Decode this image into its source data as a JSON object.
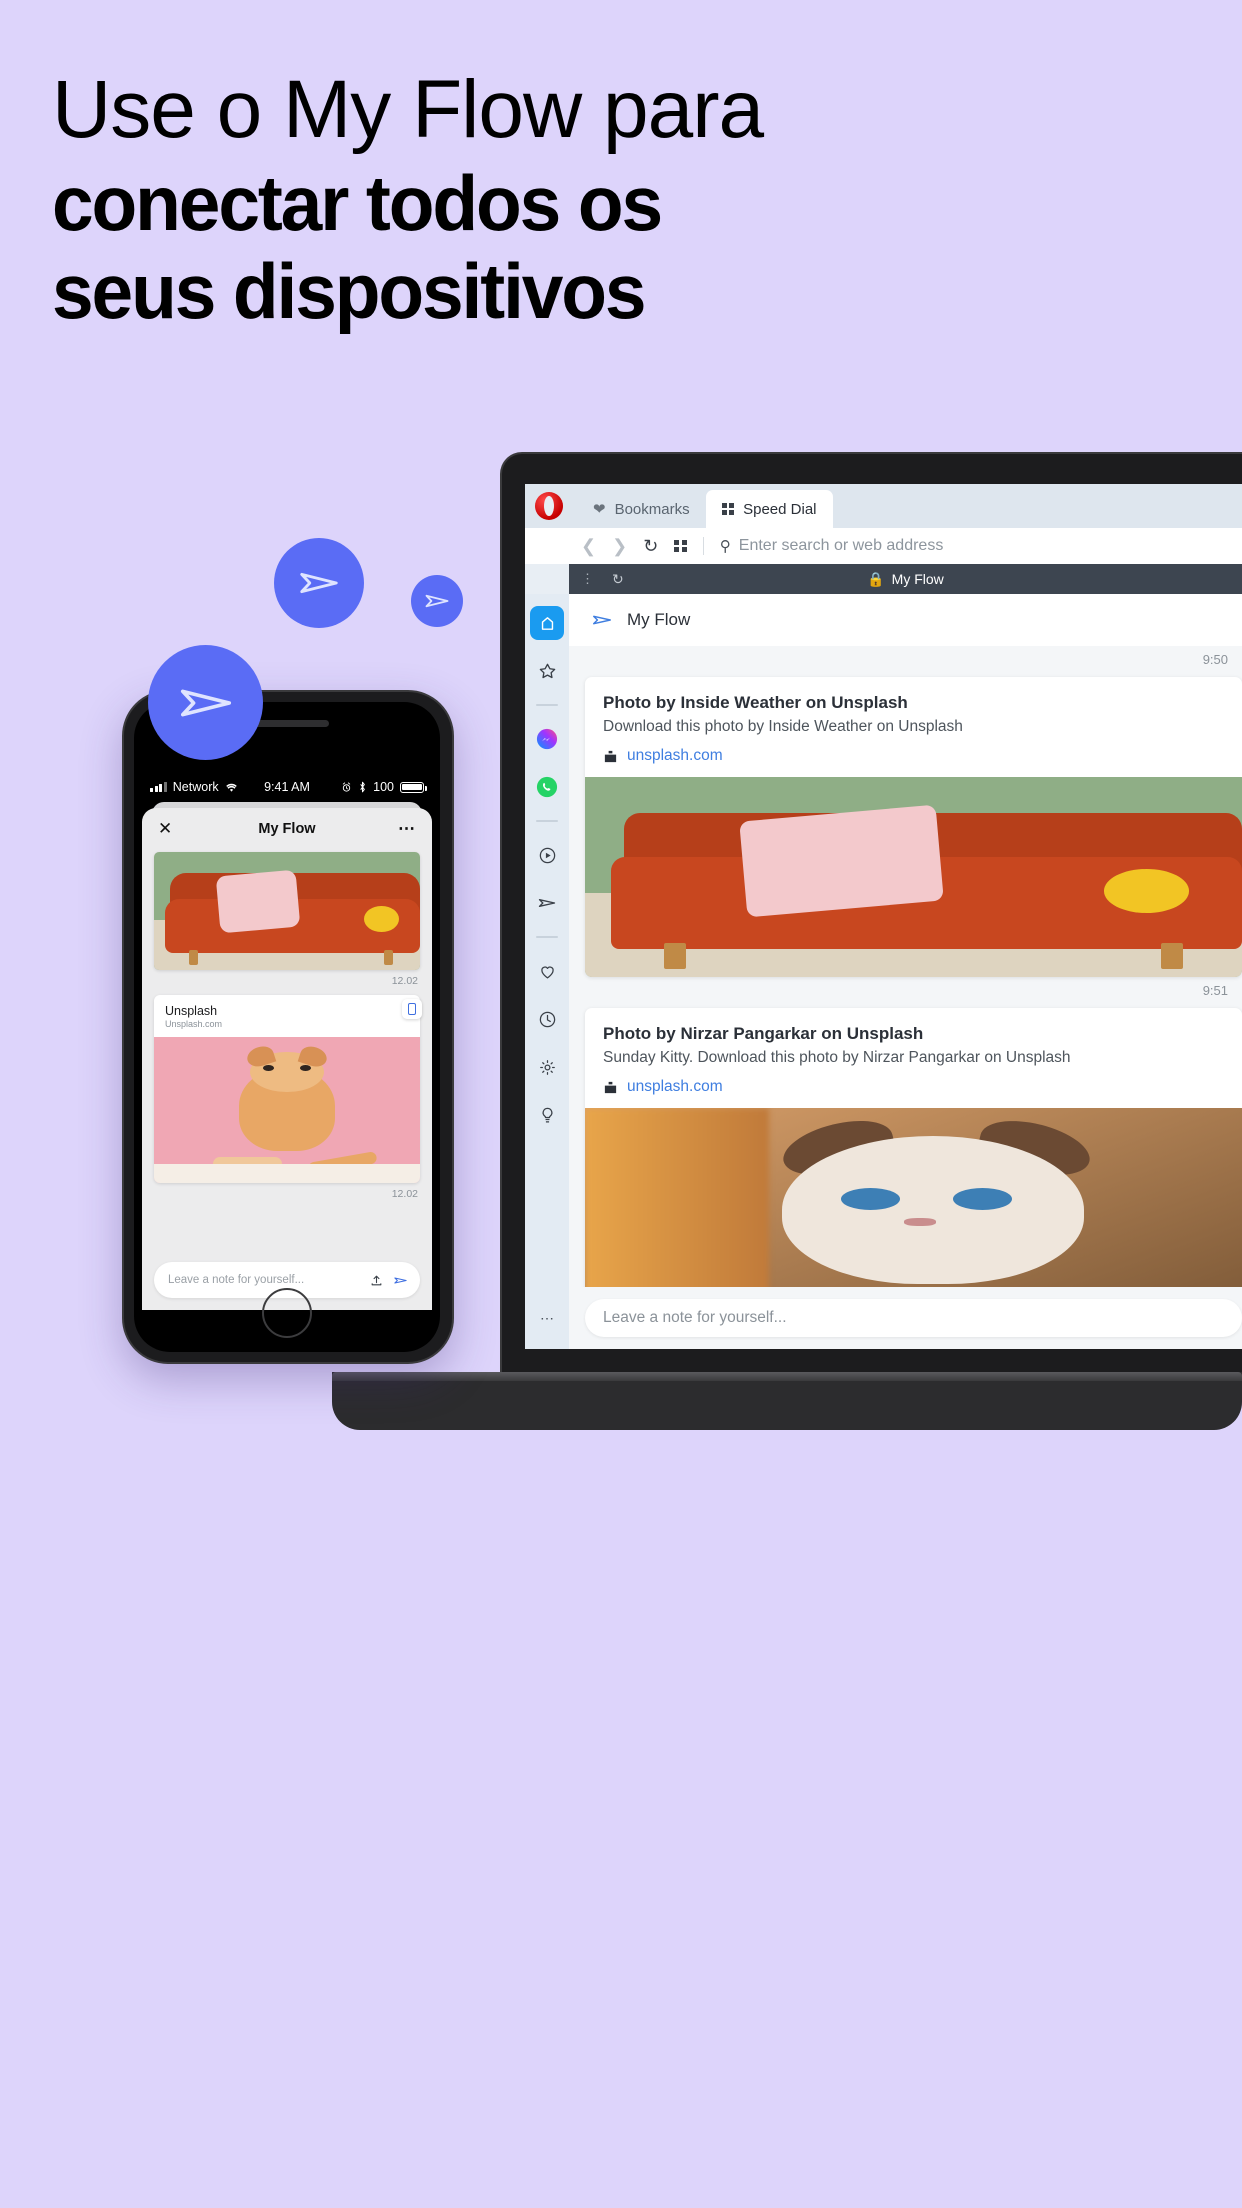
{
  "background_color": "#ddd4fb",
  "accent_color": "#5a6cf5",
  "headline": {
    "line1": "Use o My Flow para",
    "line2": "conectar todos os",
    "line3": "seus dispositivos"
  },
  "bubbles": [
    {
      "name": "flow-bubble-large",
      "icon": "send-arrow-icon"
    },
    {
      "name": "flow-bubble-medium",
      "icon": "send-arrow-icon"
    },
    {
      "name": "flow-bubble-small",
      "icon": "send-arrow-icon"
    }
  ],
  "browser": {
    "logo": "opera-logo",
    "tabs": [
      {
        "label": "Bookmarks",
        "icon": "heart-icon",
        "active": false
      },
      {
        "label": "Speed Dial",
        "icon": "grid-icon",
        "active": true
      }
    ],
    "address_bar": {
      "back_icon": "chevron-left-icon",
      "forward_icon": "chevron-right-icon",
      "reload_icon": "reload-icon",
      "speeddial_icon": "grid-icon",
      "search_icon": "search-icon",
      "placeholder": "Enter search or web address"
    },
    "page_bar": {
      "menu_icon": "vertical-dots-icon",
      "reload_icon": "reload-icon",
      "lock_icon": "lock-icon",
      "title": "My Flow"
    },
    "sidebar": {
      "items": [
        {
          "name": "home",
          "icon": "home-icon",
          "active": true
        },
        {
          "name": "favourites",
          "icon": "star-icon",
          "active": false
        },
        {
          "name": "messenger",
          "icon": "messenger-icon",
          "active": false
        },
        {
          "name": "whatsapp",
          "icon": "whatsapp-icon",
          "active": false
        },
        {
          "name": "player",
          "icon": "play-circle-icon",
          "active": false
        },
        {
          "name": "my-flow",
          "icon": "send-arrow-icon",
          "active": false
        },
        {
          "name": "hearts",
          "icon": "heart-outline-icon",
          "active": false
        },
        {
          "name": "history",
          "icon": "clock-icon",
          "active": false
        },
        {
          "name": "settings",
          "icon": "gear-icon",
          "active": false
        },
        {
          "name": "tips",
          "icon": "bulb-icon",
          "active": false
        }
      ],
      "more_icon": "horizontal-dots-icon"
    },
    "flow": {
      "header_title": "My Flow",
      "header_icon": "send-arrow-icon",
      "messages": [
        {
          "time": "9:50",
          "title": "Photo by Inside Weather on Unsplash",
          "description": "Download this photo by Inside Weather on Unsplash",
          "link": "unsplash.com",
          "link_icon": "unsplash-icon",
          "image": "orange-sofa-photo"
        },
        {
          "time": "9:51",
          "title": "Photo by Nirzar Pangarkar on Unsplash",
          "description": "Sunday Kitty. Download this photo by Nirzar Pangarkar on Unsplash",
          "link": "unsplash.com",
          "link_icon": "unsplash-icon",
          "image": "siamese-kitten-photo"
        }
      ],
      "compose_placeholder": "Leave a note for yourself..."
    }
  },
  "phone": {
    "status_bar": {
      "carrier": "Network",
      "signal_icon": "signal-bars-icon",
      "wifi_icon": "wifi-icon",
      "time": "9:41 AM",
      "alarm_icon": "alarm-icon",
      "bluetooth_icon": "bluetooth-icon",
      "battery_percent": "100",
      "battery_icon": "battery-icon"
    },
    "header": {
      "close_icon": "close-icon",
      "title": "My Flow",
      "menu_icon": "horizontal-dots-icon"
    },
    "messages": [
      {
        "image": "orange-sofa-photo",
        "time": "12.02"
      },
      {
        "title": "Unsplash",
        "subtitle": "Unsplash.com",
        "image": "ginger-cat-photo",
        "time": "12.02",
        "badge_icon": "device-icon"
      }
    ],
    "compose": {
      "placeholder": "Leave a note for yourself...",
      "upload_icon": "upload-icon",
      "send_icon": "send-arrow-icon"
    },
    "home_button": "home-button"
  }
}
